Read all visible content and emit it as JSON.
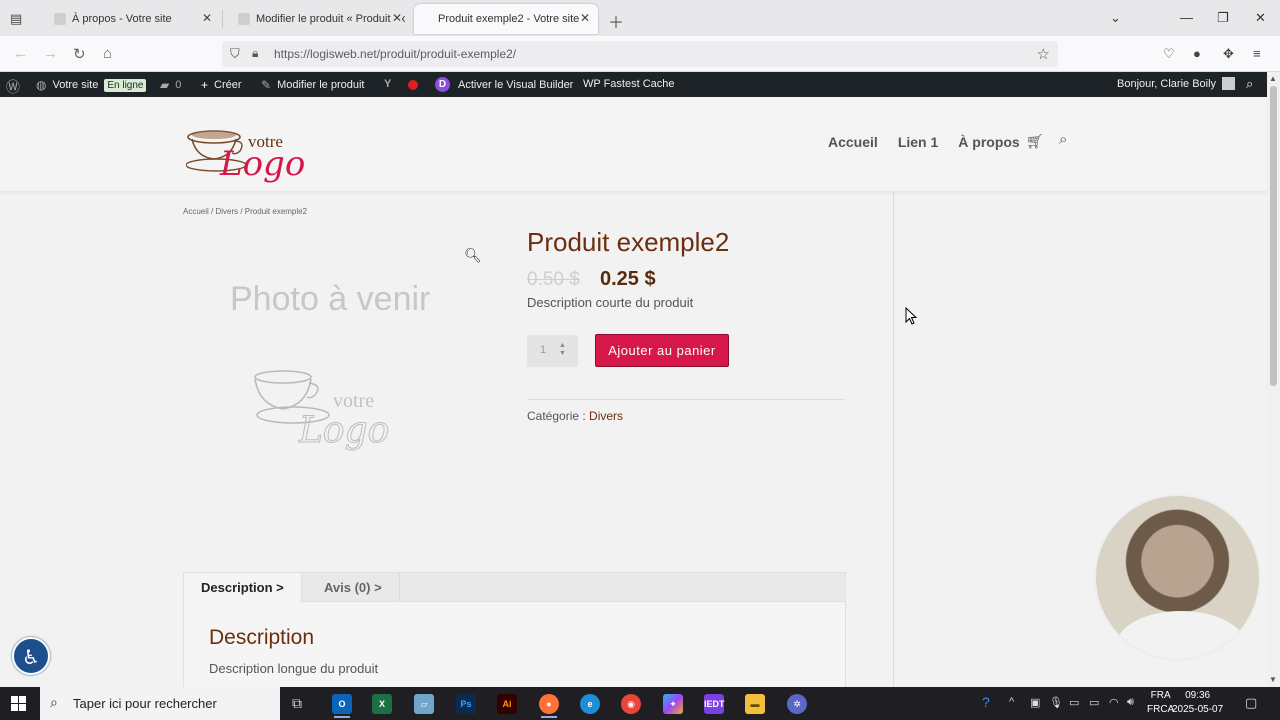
{
  "browser": {
    "tabs": [
      {
        "title": "À propos - Votre site"
      },
      {
        "title": "Modifier le produit « Produit ex"
      },
      {
        "title": "Produit exemple2 - Votre site"
      }
    ],
    "url": "https://logisweb.net/produit/produit-exemple2/"
  },
  "adminbar": {
    "site_name": "Votre site",
    "status_badge": "En ligne",
    "comments_count": "0",
    "create_label": "Créer",
    "edit_label": "Modifier le produit",
    "visual_builder_label": "Activer le Visual Builder",
    "cache_label": "WP Fastest Cache",
    "greeting": "Bonjour, Clarie Boily"
  },
  "site": {
    "logo_text_top": "votre",
    "logo_text_main": "Logo",
    "nav": [
      "Accueil",
      "Lien 1",
      "À propos"
    ]
  },
  "breadcrumb": "Accueil / Divers / Produit exemple2",
  "product": {
    "image_placeholder": "Photo à venir",
    "title": "Produit exemple2",
    "old_price": "0.50 $",
    "price": "0.25 $",
    "short_description": "Description courte du produit",
    "quantity": "1",
    "add_to_cart": "Ajouter au panier",
    "category_label": "Catégorie : ",
    "category": "Divers"
  },
  "tabs": {
    "description_tab": "Description >",
    "reviews_tab": "Avis (0) >",
    "heading": "Description",
    "long_description": "Description longue du produit"
  },
  "taskbar": {
    "search_placeholder": "Taper ici pour rechercher",
    "lang_top": "FRA",
    "lang_bottom": "FRCA",
    "time": "09:36",
    "date": "2025-05-07"
  },
  "colors": {
    "accent_button": "#d5174a",
    "title_brown": "#6b2f0f",
    "adminbar": "#1d2327"
  }
}
